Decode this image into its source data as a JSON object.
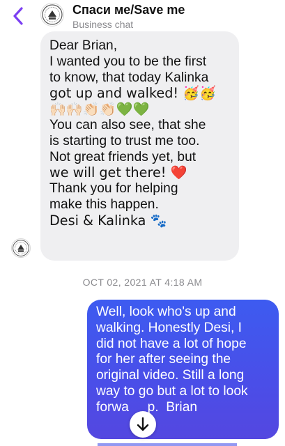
{
  "header": {
    "title": "Спаси ме/Save me",
    "subtitle": "Business chat",
    "back_icon": "chevron-left-icon",
    "accent_color": "#7b3ff2",
    "avatar_logo": "save-me-logo"
  },
  "messages": {
    "incoming": {
      "lines": [
        "Dear Brian,",
        "I wanted you to be the first",
        "to know, that today Kalinka",
        "got up and walked! 🥳🥳",
        "🙌🏻🙌🏻👏🏻👏🏻💚💚",
        "You can also see, that she",
        "is starting to trust me too.",
        "Not great friends yet, but",
        "we will get there! ❤️",
        "Thank you for helping",
        "make this happen.",
        "Desi & Kalinka 🐾"
      ],
      "bubble_color": "#efeff1"
    },
    "timestamp": "OCT 02, 2021 AT 4:18 AM",
    "outgoing": {
      "lines": [
        "Well, look who's up and",
        "walking. Honestly Desi, I",
        "did not have a lot of hope",
        "for her after seeing the",
        "original video. Still a long",
        "way to go but a lot to look",
        "forwa     p.  Brian"
      ],
      "bubble_color": "#4a4ee8"
    }
  },
  "scroll_button": {
    "icon": "arrow-down-icon"
  }
}
